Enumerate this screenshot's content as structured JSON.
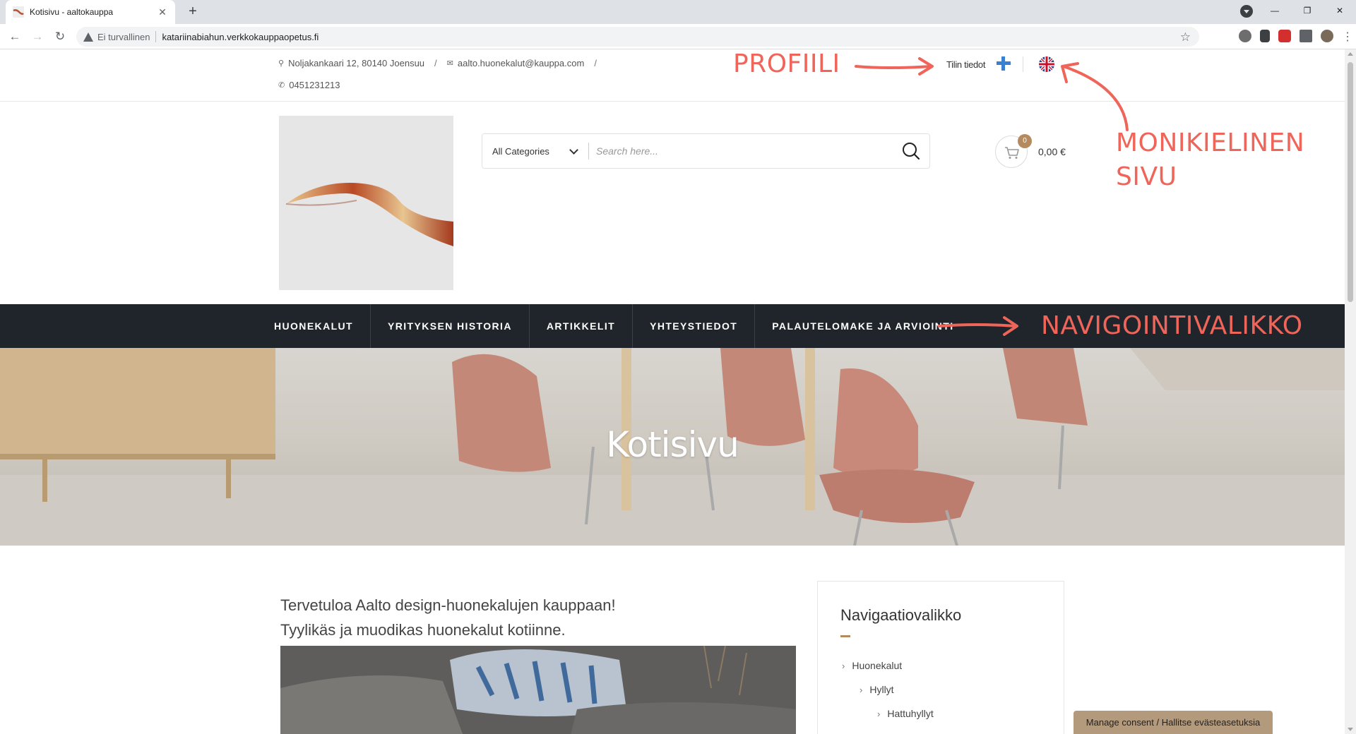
{
  "browser": {
    "tab_title": "Kotisivu - aaltokauppa",
    "tab_close": "✕",
    "new_tab": "+",
    "security_label": "Ei turvallinen",
    "url": "katariinabiahun.verkkokauppaopetus.fi",
    "window_controls": {
      "minimize": "—",
      "maximize": "❐",
      "close": "✕"
    }
  },
  "topbar": {
    "address": "Noljakankaari 12, 80140 Joensuu",
    "email": "aalto.huonekalut@kauppa.com",
    "separator": "/",
    "phone": "0451231213",
    "account_link": "Tilin tiedot"
  },
  "annotations": {
    "profile": "PROFIILI",
    "multilingual_line1": "MONIKIELINEN",
    "multilingual_line2": "SIVU",
    "navigation": "NAVIGOINTIVALIKKO",
    "arrow_color": "#f0655a"
  },
  "search": {
    "category": "All Categories",
    "placeholder": "Search here..."
  },
  "cart": {
    "count": "0",
    "total": "0,00 €"
  },
  "nav": {
    "items": [
      "HUONEKALUT",
      "YRITYKSEN HISTORIA",
      "ARTIKKELIT",
      "YHTEYSTIEDOT",
      "PALAUTELOMAKE JA ARVIOINTI"
    ]
  },
  "hero": {
    "title": "Kotisivu"
  },
  "content": {
    "welcome_line1": "Tervetuloa Aalto design-huonekalujen kauppaan!",
    "welcome_line2": "Tyylikäs ja muodikas huonekalut kotiinne."
  },
  "sidebar_widget": {
    "title": "Navigaatiovalikko",
    "items": [
      "Huonekalut",
      "Hyllyt",
      "Hattuhyllyt"
    ]
  },
  "consent": {
    "label": "Manage consent / Hallitse evästeasetuksia"
  },
  "colors": {
    "nav_bg": "#1f252b",
    "accent": "#b48a5e",
    "annotation": "#f0655a"
  }
}
